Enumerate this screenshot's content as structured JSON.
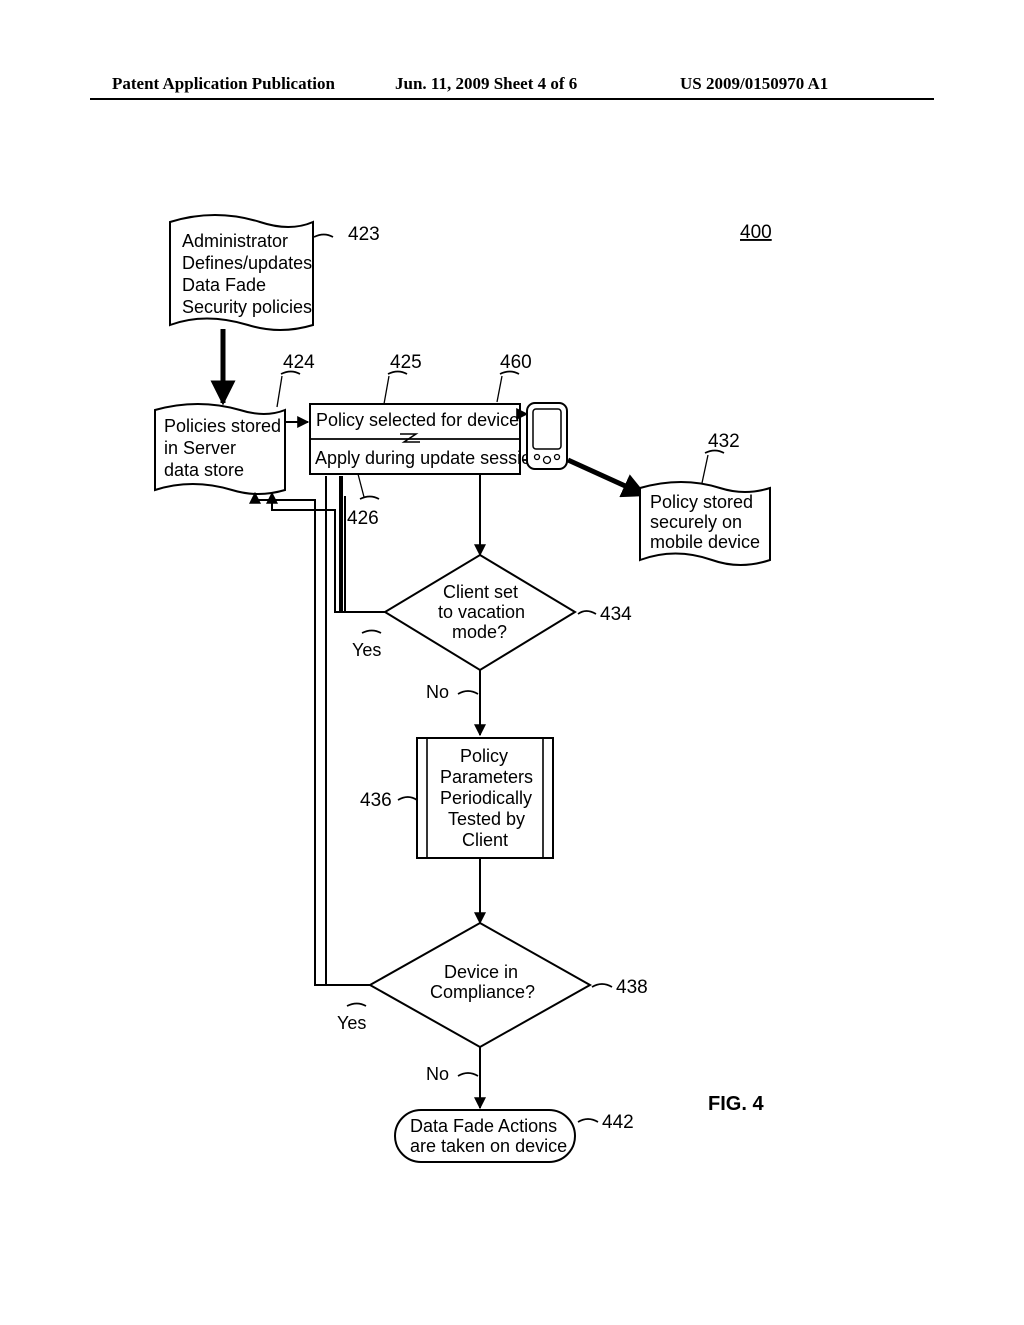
{
  "header": {
    "left": "Patent Application Publication",
    "mid": "Jun. 11, 2009  Sheet 4 of 6",
    "right": "US 2009/0150970 A1"
  },
  "figure_number": "400",
  "figure_label": "FIG. 4",
  "refs": {
    "r423": "423",
    "r424": "424",
    "r425": "425",
    "r426": "426",
    "r432": "432",
    "r434": "434",
    "r436": "436",
    "r438": "438",
    "r442": "442",
    "r460": "460"
  },
  "labels": {
    "yes1": "Yes",
    "yes2": "Yes",
    "no1": "No",
    "no2": "No"
  },
  "nodes": {
    "doc423": {
      "l1": "Administrator",
      "l2": "Defines/updates",
      "l3": "Data Fade",
      "l4": "Security policies"
    },
    "doc424": {
      "l1": "Policies stored",
      "l2": "in Server",
      "l3": "data store"
    },
    "proc425": "Policy selected for device",
    "proc426": "Apply during update session",
    "doc432": {
      "l1": "Policy stored",
      "l2": "securely on",
      "l3": "mobile device"
    },
    "dec434": {
      "l1": "Client set",
      "l2": "to vacation",
      "l3": "mode?"
    },
    "proc436": {
      "l1": "Policy",
      "l2": "Parameters",
      "l3": "Periodically",
      "l4": "Tested by",
      "l5": "Client"
    },
    "dec438": {
      "l1": "Device in",
      "l2": "Compliance?"
    },
    "term442": {
      "l1": "Data Fade Actions",
      "l2": "are taken on device"
    }
  },
  "chart_data": {
    "type": "flowchart",
    "title": "FIG. 4",
    "figure_id": "400",
    "nodes": [
      {
        "id": "423",
        "shape": "document",
        "text": "Administrator Defines/updates Data Fade Security policies"
      },
      {
        "id": "424",
        "shape": "document",
        "text": "Policies stored in Server data store"
      },
      {
        "id": "425",
        "shape": "process",
        "text": "Policy selected for device"
      },
      {
        "id": "426",
        "shape": "process",
        "text": "Apply during update session"
      },
      {
        "id": "460",
        "shape": "device",
        "text": "(mobile device icon)"
      },
      {
        "id": "432",
        "shape": "document",
        "text": "Policy stored securely on mobile device"
      },
      {
        "id": "434",
        "shape": "decision",
        "text": "Client set to vacation mode?"
      },
      {
        "id": "436",
        "shape": "process",
        "text": "Policy Parameters Periodically Tested by Client"
      },
      {
        "id": "438",
        "shape": "decision",
        "text": "Device in Compliance?"
      },
      {
        "id": "442",
        "shape": "terminator",
        "text": "Data Fade Actions are taken on device"
      }
    ],
    "edges": [
      {
        "from": "423",
        "to": "424"
      },
      {
        "from": "424",
        "to": "425"
      },
      {
        "from": "425",
        "to": "460"
      },
      {
        "from": "460",
        "to": "426"
      },
      {
        "from": "426",
        "to": "432",
        "thick": true
      },
      {
        "from": "426",
        "to": "434"
      },
      {
        "from": "434",
        "to": "424",
        "label": "Yes"
      },
      {
        "from": "434",
        "to": "436",
        "label": "No"
      },
      {
        "from": "436",
        "to": "438"
      },
      {
        "from": "438",
        "to": "424",
        "label": "Yes"
      },
      {
        "from": "438",
        "to": "442",
        "label": "No"
      }
    ]
  }
}
